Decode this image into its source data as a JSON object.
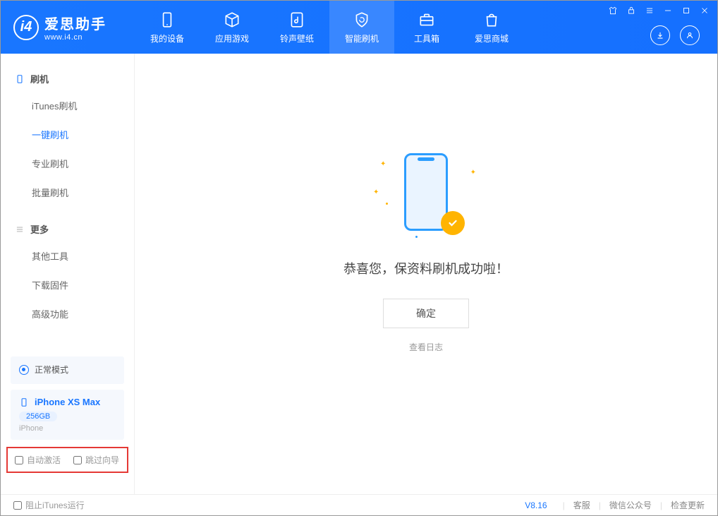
{
  "app": {
    "title": "爱思助手",
    "subtitle": "www.i4.cn"
  },
  "nav": [
    {
      "key": "device",
      "label": "我的设备"
    },
    {
      "key": "apps",
      "label": "应用游戏"
    },
    {
      "key": "ringtone",
      "label": "铃声壁纸"
    },
    {
      "key": "flash",
      "label": "智能刷机",
      "active": true
    },
    {
      "key": "toolbox",
      "label": "工具箱"
    },
    {
      "key": "store",
      "label": "爱思商城"
    }
  ],
  "sidebar": {
    "section1_title": "刷机",
    "items1": [
      {
        "label": "iTunes刷机"
      },
      {
        "label": "一键刷机",
        "active": true
      },
      {
        "label": "专业刷机"
      },
      {
        "label": "批量刷机"
      }
    ],
    "section2_title": "更多",
    "items2": [
      {
        "label": "其他工具"
      },
      {
        "label": "下载固件"
      },
      {
        "label": "高级功能"
      }
    ]
  },
  "device_status": {
    "mode": "正常模式"
  },
  "device_info": {
    "name": "iPhone XS Max",
    "capacity": "256GB",
    "type": "iPhone"
  },
  "options": {
    "auto_activate": "自动激活",
    "skip_guide": "跳过向导"
  },
  "main": {
    "success_message": "恭喜您，保资料刷机成功啦！",
    "confirm": "确定",
    "view_log": "查看日志"
  },
  "footer": {
    "block_itunes": "阻止iTunes运行",
    "version": "V8.16",
    "links": [
      "客服",
      "微信公众号",
      "检查更新"
    ]
  }
}
